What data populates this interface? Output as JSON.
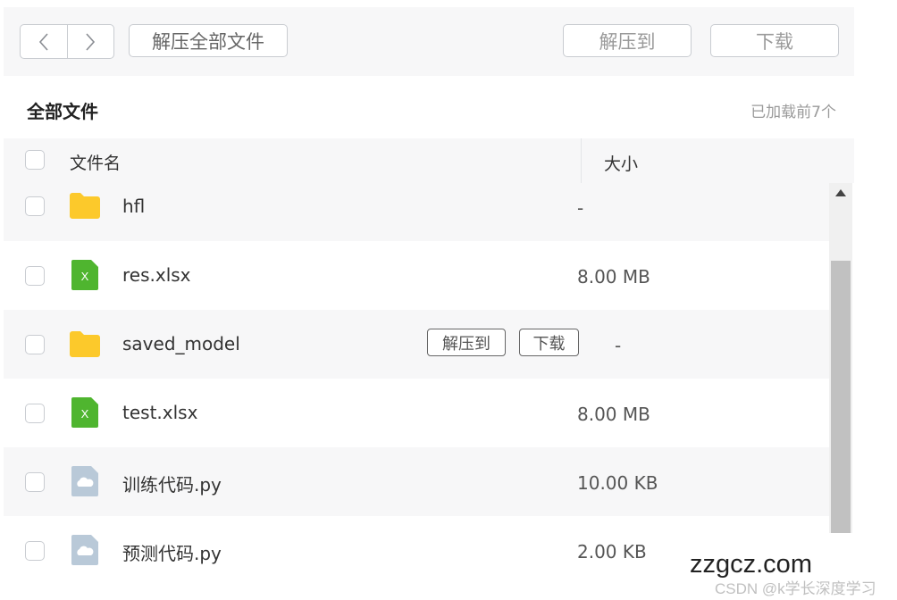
{
  "toolbar": {
    "back_icon": "chevron-left-icon",
    "forward_icon": "chevron-right-icon",
    "extract_all_label": "解压全部文件",
    "extract_to_label": "解压到",
    "download_label": "下载"
  },
  "list_title": "全部文件",
  "loaded_text": "已加载前7个",
  "columns": {
    "name": "文件名",
    "size": "大小"
  },
  "files": [
    {
      "name": "hfl",
      "size": "-",
      "icon": "folder-icon"
    },
    {
      "name": "res.xlsx",
      "size": "8.00 MB",
      "icon": "excel-file-icon"
    },
    {
      "name": "saved_model",
      "size": "-",
      "icon": "folder-icon",
      "actions": {
        "extract_to": "解压到",
        "download": "下载"
      }
    },
    {
      "name": "test.xlsx",
      "size": "8.00 MB",
      "icon": "excel-file-icon"
    },
    {
      "name": "训练代码.py",
      "size": "10.00 KB",
      "icon": "generic-file-icon"
    },
    {
      "name": "预测代码.py",
      "size": "2.00 KB",
      "icon": "generic-file-icon"
    }
  ],
  "watermark": {
    "site": "zzgcz.com",
    "credit": "CSDN @k学长深度学习"
  },
  "colors": {
    "folder": "#fcc92b",
    "excel": "#4fb52f",
    "generic_file": "#b9c9d8",
    "row_alt": "#f7f7f8"
  }
}
